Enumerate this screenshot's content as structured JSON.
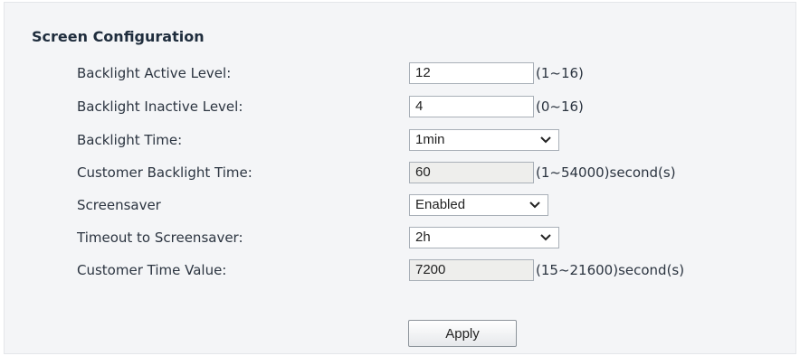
{
  "section": {
    "title": "Screen Configuration"
  },
  "fields": {
    "backlight_active_level": {
      "label": "Backlight Active Level:",
      "value": "12",
      "range": "(1~16)"
    },
    "backlight_inactive_level": {
      "label": "Backlight Inactive Level:",
      "value": "4",
      "range": "(0~16)"
    },
    "backlight_time": {
      "label": "Backlight Time:",
      "value": "1min"
    },
    "customer_backlight_time": {
      "label": "Customer Backlight Time:",
      "value": "60",
      "range": "(1~54000)second(s)"
    },
    "screensaver": {
      "label": "Screensaver",
      "value": "Enabled"
    },
    "timeout_to_screensaver": {
      "label": "Timeout to Screensaver:",
      "value": "2h"
    },
    "customer_time_value": {
      "label": "Customer Time Value:",
      "value": "7200",
      "range": "(15~21600)second(s)"
    }
  },
  "actions": {
    "apply_label": "Apply"
  },
  "icons": {
    "dropdown": "chevron-down-icon"
  },
  "colors": {
    "panel_bg": "#f4f5f7",
    "readonly_bg": "#eeeeec",
    "border": "#a9b0b8"
  }
}
